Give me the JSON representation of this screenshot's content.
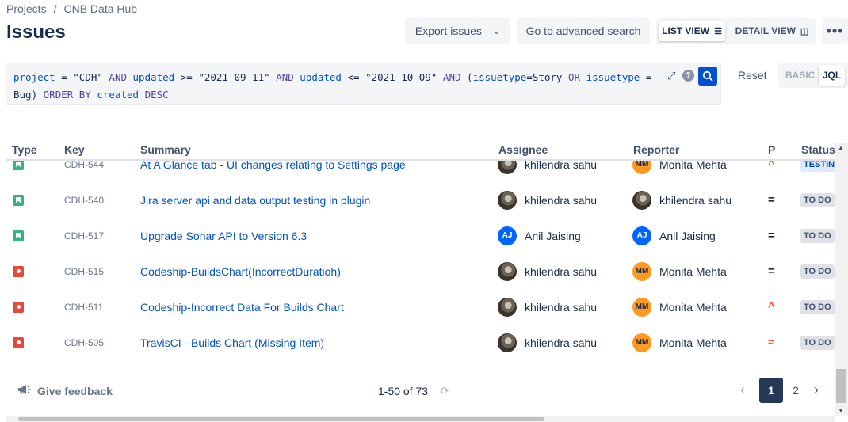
{
  "breadcrumb": {
    "projects": "Projects",
    "separator": "/",
    "project": "CNB Data Hub"
  },
  "title": "Issues",
  "toolbar": {
    "export": "Export issues",
    "advanced": "Go to advanced search",
    "list_view": "LIST VIEW",
    "detail_view": "DETAIL VIEW",
    "more": "•••"
  },
  "search": {
    "jql_parts": [
      [
        "fld",
        "project"
      ],
      [
        "op",
        " = "
      ],
      [
        "txt",
        "\"CDH\" "
      ],
      [
        "kw",
        "AND "
      ],
      [
        "fld",
        "updated"
      ],
      [
        "op",
        " >= "
      ],
      [
        "txt",
        "\"2021-09-11\" "
      ],
      [
        "kw",
        "AND "
      ],
      [
        "fld",
        "updated"
      ],
      [
        "op",
        " <= "
      ],
      [
        "txt",
        "\"2021-10-09\" "
      ],
      [
        "kw",
        "AND "
      ],
      [
        "txt",
        "("
      ],
      [
        "fld",
        "issuetype"
      ],
      [
        "op",
        "="
      ],
      [
        "txt",
        "Story "
      ],
      [
        "kw",
        "OR "
      ],
      [
        "fld",
        "issuetype"
      ],
      [
        "op",
        " = "
      ],
      [
        "txt",
        "Bug) "
      ],
      [
        "kw",
        "ORDER BY "
      ],
      [
        "fld",
        "created"
      ],
      [
        "txt",
        " "
      ],
      [
        "kw",
        "DESC"
      ]
    ],
    "help": "?",
    "reset": "Reset",
    "basic": "BASIC",
    "jql": "JQL"
  },
  "columns": {
    "type": "Type",
    "key": "Key",
    "summary": "Summary",
    "assignee": "Assignee",
    "reporter": "Reporter",
    "priority": "P",
    "status": "Status"
  },
  "issues": [
    {
      "type": "story",
      "key": "CDH-544",
      "summary": "At A Glance tab - UI changes relating to Settings page",
      "assignee": "khilendra sahu",
      "assignee_avatar": "photo",
      "reporter": "Monita Mehta",
      "reporter_avatar": "MM",
      "priority": "high",
      "status": "TESTING"
    },
    {
      "type": "story",
      "key": "CDH-540",
      "summary": "Jira server api and data output testing in plugin",
      "assignee": "khilendra sahu",
      "assignee_avatar": "photo",
      "reporter": "khilendra sahu",
      "reporter_avatar": "photo",
      "priority": "medium",
      "status": "TO DO"
    },
    {
      "type": "story",
      "key": "CDH-517",
      "summary": "Upgrade Sonar API to Version 6.3",
      "assignee": "Anil Jaising",
      "assignee_avatar": "AJ",
      "reporter": "Anil Jaising",
      "reporter_avatar": "AJ",
      "priority": "medium",
      "status": "TO DO"
    },
    {
      "type": "bug",
      "key": "CDH-515",
      "summary": "Codeship-BuildsChart(IncorrectDuratioh)",
      "assignee": "khilendra sahu",
      "assignee_avatar": "photo",
      "reporter": "Monita Mehta",
      "reporter_avatar": "MM",
      "priority": "medium",
      "status": "TO DO"
    },
    {
      "type": "bug",
      "key": "CDH-511",
      "summary": "Codeship-Incorrect Data For Builds Chart",
      "assignee": "khilendra sahu",
      "assignee_avatar": "photo",
      "reporter": "Monita Mehta",
      "reporter_avatar": "MM",
      "priority": "high",
      "status": "TO DO"
    },
    {
      "type": "bug",
      "key": "CDH-505",
      "summary": "TravisCI - Builds Chart (Missing Item)",
      "assignee": "khilendra sahu",
      "assignee_avatar": "photo",
      "reporter": "Monita Mehta",
      "reporter_avatar": "MM",
      "priority": "highest",
      "status": "TO DO"
    }
  ],
  "footer": {
    "feedback": "Give feedback",
    "count": "1-50 of 73",
    "pages": [
      "1",
      "2"
    ],
    "current_page": "1"
  },
  "colors": {
    "primary": "#0052cc",
    "story": "#36b37e",
    "bug": "#e5493a",
    "medium": "#ffab00",
    "high": "#ff5630"
  }
}
